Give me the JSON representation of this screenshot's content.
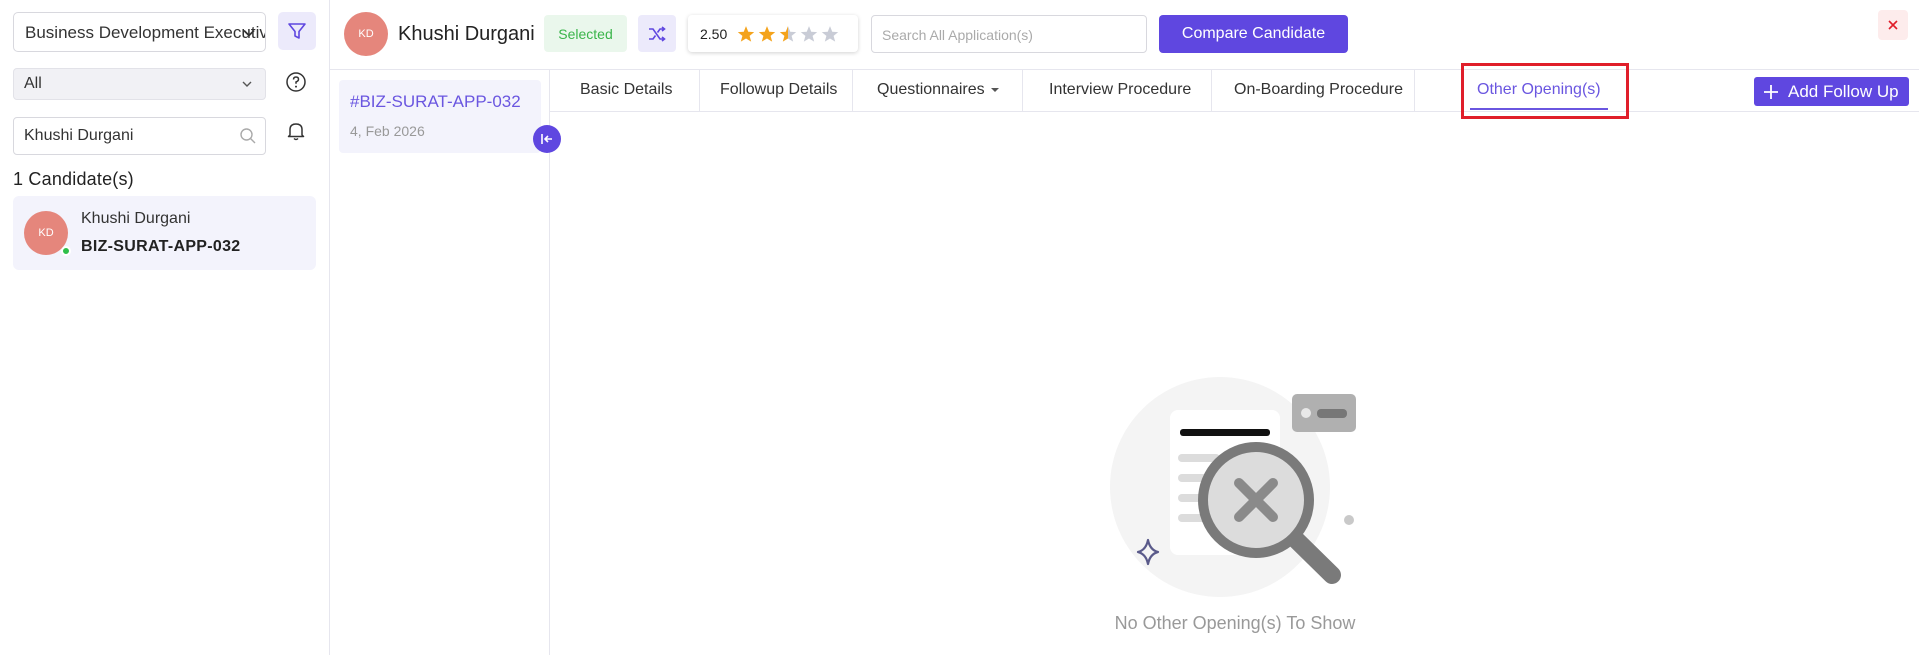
{
  "sidebar": {
    "job_select": "Business Development Executive",
    "status_select": "All",
    "search_value": "Khushi Durgani",
    "candidate_count": "1 Candidate(s)",
    "candidate": {
      "initials": "KD",
      "name": "Khushi Durgani",
      "app_id": "BIZ-SURAT-APP-032"
    }
  },
  "header": {
    "initials": "KD",
    "name": "Khushi Durgani",
    "status_badge": "Selected",
    "rating": "2.50",
    "rating_value": 2.5,
    "rating_max": 5,
    "search_placeholder": "Search All Application(s)",
    "compare_label": "Compare Candidate"
  },
  "application": {
    "id": "#BIZ-SURAT-APP-032",
    "date": "4, Feb 2026"
  },
  "tabs": [
    {
      "label": "Basic Details"
    },
    {
      "label": "Followup Details"
    },
    {
      "label": "Questionnaires"
    },
    {
      "label": "Interview Procedure"
    },
    {
      "label": "On-Boarding Procedure"
    },
    {
      "label": "Other Opening(s)"
    }
  ],
  "active_tab": "Other Opening(s)",
  "add_followup_label": "Add Follow Up",
  "empty_state": "No Other Opening(s) To Show",
  "colors": {
    "accent": "#5f47e0",
    "avatar": "#e5867c",
    "selected_green": "#3ab54a",
    "highlight_red": "#e01e2a"
  }
}
